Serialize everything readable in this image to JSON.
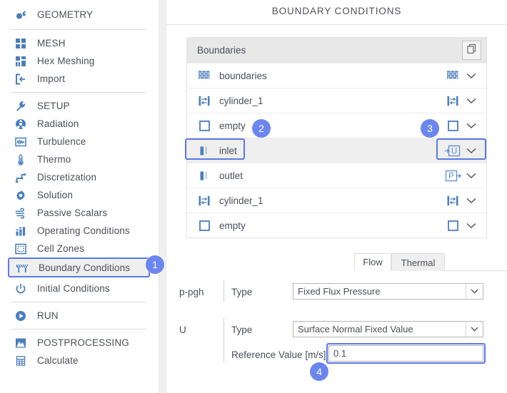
{
  "colors": {
    "accent": "#5a78e8",
    "badge": "#6b86ef",
    "icon_blue": "#4a7ebb",
    "text": "#4a4f59",
    "panel_header_bg": "#e8e8e8",
    "row_selected_bg": "#efefef"
  },
  "sidebar": {
    "groups": [
      {
        "items": [
          {
            "label": "GEOMETRY",
            "icon": "geometry-icon"
          }
        ]
      },
      {
        "items": [
          {
            "label": "MESH",
            "icon": "mesh-grid-icon"
          },
          {
            "label": "Hex Meshing",
            "icon": "hex-mesh-icon"
          },
          {
            "label": "Import",
            "icon": "import-arrow-icon"
          }
        ]
      },
      {
        "items": [
          {
            "label": "SETUP",
            "icon": "wrench-icon"
          },
          {
            "label": "Radiation",
            "icon": "radiation-icon"
          },
          {
            "label": "Turbulence",
            "icon": "turbulence-waveform-icon"
          },
          {
            "label": "Thermo",
            "icon": "thermometer-icon"
          },
          {
            "label": "Discretization",
            "icon": "discretization-icon"
          },
          {
            "label": "Solution",
            "icon": "gear-icon"
          },
          {
            "label": "Passive Scalars",
            "icon": "wind-icon"
          },
          {
            "label": "Operating Conditions",
            "icon": "bar-chart-icon"
          },
          {
            "label": "Cell Zones",
            "icon": "cell-zones-icon"
          },
          {
            "label": "Boundary Conditions",
            "icon": "barrier-icon",
            "selected": true
          },
          {
            "label": "Initial Conditions",
            "icon": "power-icon"
          }
        ]
      },
      {
        "items": [
          {
            "label": "RUN",
            "icon": "play-circle-icon"
          }
        ]
      },
      {
        "items": [
          {
            "label": "POSTPROCESSING",
            "icon": "postprocessing-icon"
          },
          {
            "label": "Calculate",
            "icon": "calculator-icon"
          }
        ]
      }
    ]
  },
  "main": {
    "title": "BOUNDARY CONDITIONS",
    "boundaries_panel": {
      "header_label": "Boundaries",
      "copy_button_icon": "copy-icon",
      "rows": [
        {
          "name": "boundaries",
          "left_icon": "brick-wall-icon",
          "right_icon": "brick-wall-icon",
          "right_icon_label": "",
          "chevron": "chevron-down-icon",
          "selected": false
        },
        {
          "name": "cylinder_1",
          "left_icon": "cyclic-icon",
          "right_icon": "cyclic-icon",
          "right_icon_label": "",
          "chevron": "chevron-down-icon",
          "selected": false
        },
        {
          "name": "empty",
          "left_icon": "empty-square-icon",
          "right_icon": "empty-square-icon",
          "right_icon_label": "",
          "chevron": "chevron-down-icon",
          "selected": false
        },
        {
          "name": "inlet",
          "left_icon": "patch-icon",
          "right_icon": "inlet-u-icon",
          "right_icon_label": "U",
          "chevron": "chevron-down-icon",
          "selected": true
        },
        {
          "name": "outlet",
          "left_icon": "patch-icon",
          "right_icon": "outlet-p-icon",
          "right_icon_label": "P",
          "chevron": "chevron-down-icon",
          "selected": false
        },
        {
          "name": "cylinder_1",
          "left_icon": "cyclic-icon",
          "right_icon": "cyclic-icon",
          "right_icon_label": "",
          "chevron": "chevron-down-icon",
          "selected": false
        },
        {
          "name": "empty",
          "left_icon": "empty-square-icon",
          "right_icon": "empty-square-icon",
          "right_icon_label": "",
          "chevron": "chevron-down-icon",
          "selected": false
        }
      ]
    },
    "tabs": [
      {
        "label": "Flow",
        "active": true
      },
      {
        "label": "Thermal",
        "active": false
      }
    ],
    "form": {
      "ppgh": {
        "group_label": "p-pgh",
        "type_label": "Type",
        "type_value": "Fixed Flux Pressure"
      },
      "u": {
        "group_label": "U",
        "type_label": "Type",
        "type_value": "Surface Normal Fixed Value",
        "reference_label": "Reference Value [m/s]",
        "reference_value": "0.1"
      }
    }
  },
  "annotations": [
    {
      "number": "1",
      "target": "sidebar-item-boundary-conditions"
    },
    {
      "number": "2",
      "target": "boundary-row-inlet-name"
    },
    {
      "number": "3",
      "target": "boundary-row-inlet-type-icon"
    },
    {
      "number": "4",
      "target": "reference-value-input"
    }
  ]
}
